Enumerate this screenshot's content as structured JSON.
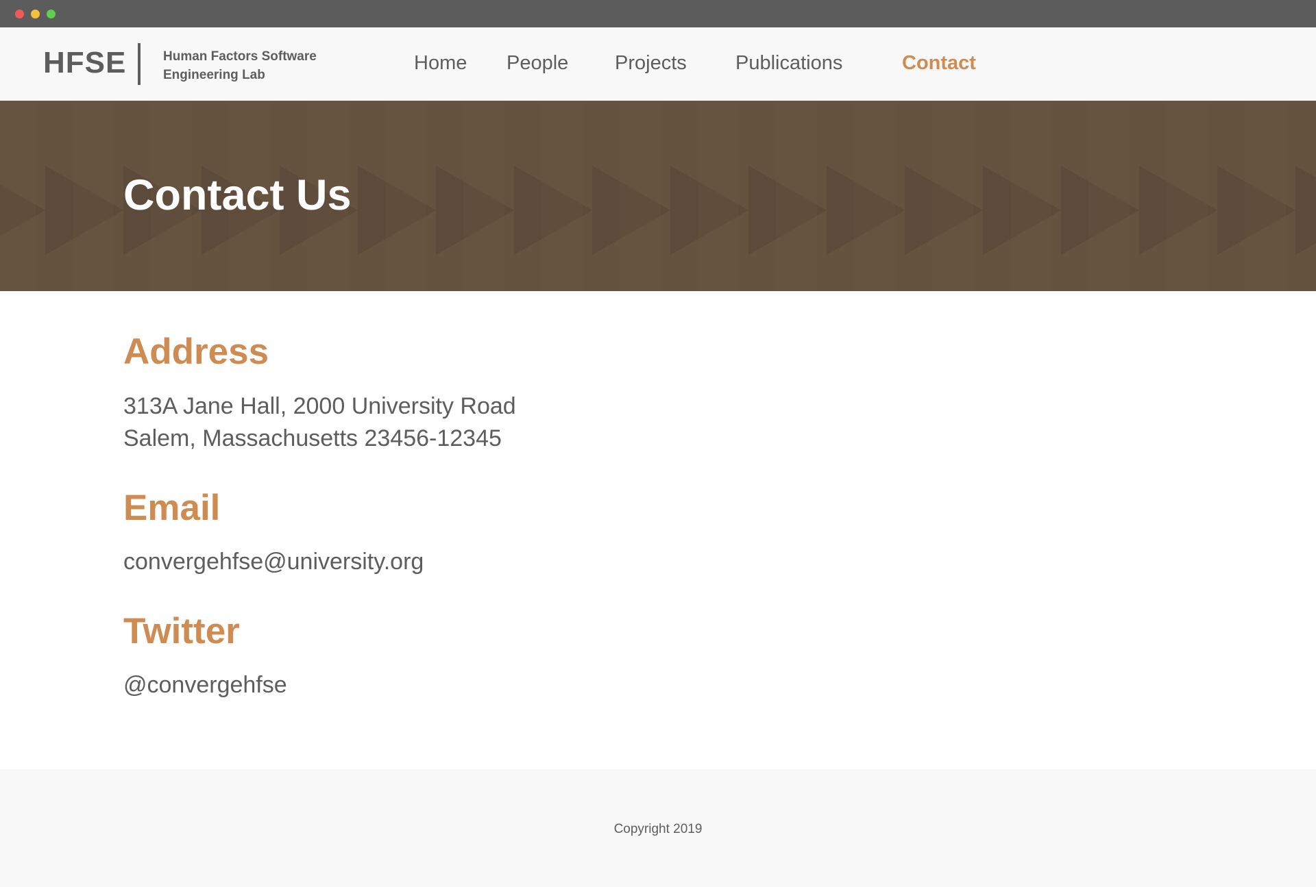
{
  "window": {
    "controls": [
      "close",
      "minimize",
      "maximize"
    ]
  },
  "header": {
    "logo": "HFSE",
    "tagline_line1": "Human Factors Software",
    "tagline_line2": "Engineering Lab",
    "nav": [
      {
        "label": "Home",
        "active": false
      },
      {
        "label": "People",
        "active": false
      },
      {
        "label": "Projects",
        "active": false
      },
      {
        "label": "Publications",
        "active": false
      },
      {
        "label": "Contact",
        "active": true
      }
    ]
  },
  "banner": {
    "title": "Contact Us"
  },
  "sections": {
    "address": {
      "heading": "Address",
      "line1": "313A Jane Hall, 2000 University Road",
      "line2": "Salem, Massachusetts 23456-12345"
    },
    "email": {
      "heading": "Email",
      "value": "convergehfse@university.org"
    },
    "twitter": {
      "heading": "Twitter",
      "value": "@convergehfse"
    }
  },
  "footer": {
    "copyright": "Copyright 2019"
  },
  "colors": {
    "accent": "#cf8c52",
    "text": "#5d5d5d",
    "banner": "#65523f",
    "header_bg": "#f8f8f8",
    "chrome": "#5c5c5c"
  }
}
